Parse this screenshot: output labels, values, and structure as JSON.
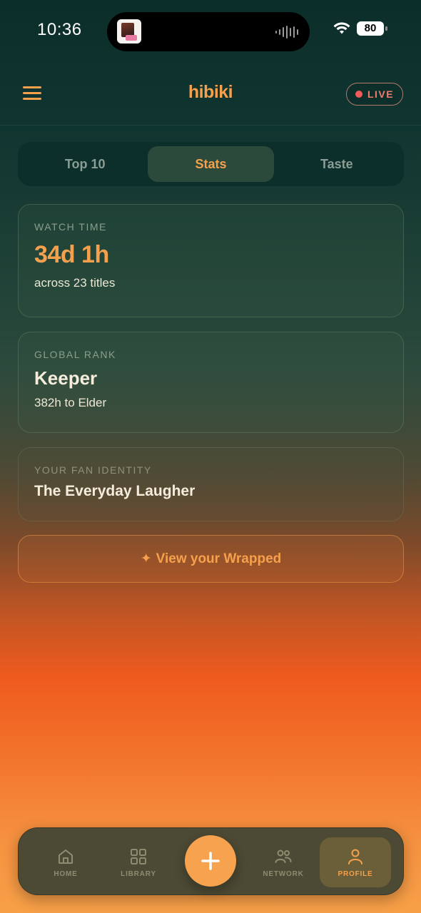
{
  "status_bar": {
    "time": "10:36",
    "battery": "80",
    "icons": [
      "album-art-icon",
      "audio-wave-icon",
      "wifi-icon",
      "battery-icon"
    ]
  },
  "header": {
    "brand": "hibiki",
    "live_label": "LIVE",
    "menu_icon": "hamburger-menu-icon"
  },
  "tabs": [
    {
      "label": "Top 10",
      "active": false
    },
    {
      "label": "Stats",
      "active": true
    },
    {
      "label": "Taste",
      "active": false
    }
  ],
  "stats": {
    "watch_time": {
      "label": "WATCH TIME",
      "value": "34d 1h",
      "sub": "across 23 titles"
    },
    "global_rank": {
      "label": "GLOBAL RANK",
      "value": "Keeper",
      "sub": "382h to Elder"
    },
    "fan_identity": {
      "label": "YOUR FAN IDENTITY",
      "value": "The Everyday Laugher"
    }
  },
  "wrapped_button": {
    "icon": "✦",
    "label": "View your Wrapped"
  },
  "bottom_nav": {
    "items": [
      {
        "label": "HOME",
        "icon": "home-icon"
      },
      {
        "label": "LIBRARY",
        "icon": "grid-icon"
      },
      {
        "label": "NETWORK",
        "icon": "people-icon"
      },
      {
        "label": "PROFILE",
        "icon": "person-icon",
        "active": true
      }
    ],
    "fab_icon": "plus-icon"
  },
  "colors": {
    "accent": "#f5a04c",
    "live": "#f05a5a",
    "bg_top": "#0c2e2a",
    "bg_mid": "#ef5a1e"
  }
}
